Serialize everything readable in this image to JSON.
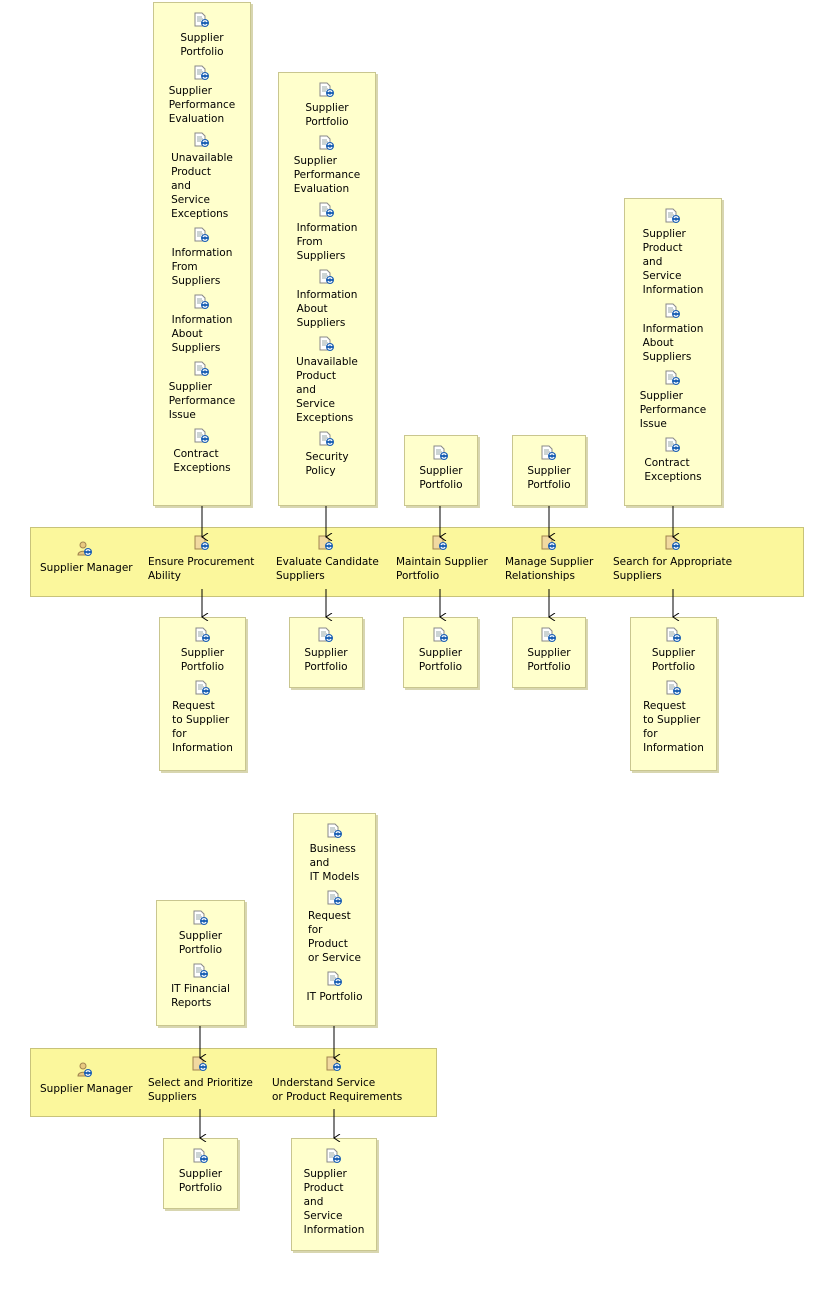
{
  "colors": {
    "lane": "#fbf79c",
    "box": "#ffffcc",
    "icon_blue": "#1a5fb4"
  },
  "lanes": [
    {
      "actor": "Supplier Manager",
      "tasks": [
        {
          "name": "Ensure Procurement\nAbility",
          "inputs": [
            "Supplier\nPortfolio",
            "Supplier\nPerformance\nEvaluation",
            "Unavailable\nProduct\nand\nService\nExceptions",
            "Information\nFrom\nSuppliers",
            "Information\nAbout\nSuppliers",
            "Supplier\nPerformance\nIssue",
            "Contract\nExceptions"
          ],
          "outputs": [
            "Supplier\nPortfolio",
            "Request\nto Supplier\nfor\nInformation"
          ]
        },
        {
          "name": "Evaluate Candidate\nSuppliers",
          "inputs": [
            "Supplier\nPortfolio",
            "Supplier\nPerformance\nEvaluation",
            "Information\nFrom\nSuppliers",
            "Information\nAbout\nSuppliers",
            "Unavailable\nProduct\nand\nService\nExceptions",
            "Security\nPolicy"
          ],
          "outputs": [
            "Supplier\nPortfolio"
          ]
        },
        {
          "name": "Maintain Supplier\nPortfolio",
          "inputs": [
            "Supplier\nPortfolio"
          ],
          "outputs": [
            "Supplier\nPortfolio"
          ]
        },
        {
          "name": "Manage Supplier\nRelationships",
          "inputs": [
            "Supplier\nPortfolio"
          ],
          "outputs": [
            "Supplier\nPortfolio"
          ]
        },
        {
          "name": "Search for Appropriate\nSuppliers",
          "inputs": [
            "Supplier\nProduct\nand\nService\nInformation",
            "Information\nAbout\nSuppliers",
            "Supplier\nPerformance\nIssue",
            "Contract\nExceptions"
          ],
          "outputs": [
            "Supplier\nPortfolio",
            "Request\nto Supplier\nfor\nInformation"
          ]
        }
      ]
    },
    {
      "actor": "Supplier Manager",
      "tasks": [
        {
          "name": "Select and Prioritize\nSuppliers",
          "inputs": [
            "Supplier\nPortfolio",
            "IT Financial\nReports"
          ],
          "outputs": [
            "Supplier\nPortfolio"
          ]
        },
        {
          "name": "Understand Service\nor Product Requirements",
          "inputs": [
            "Business\nand\nIT Models",
            "Request\nfor\nProduct\nor Service",
            "IT Portfolio"
          ],
          "outputs": [
            "Supplier\nProduct\nand\nService\nInformation"
          ]
        }
      ]
    }
  ]
}
